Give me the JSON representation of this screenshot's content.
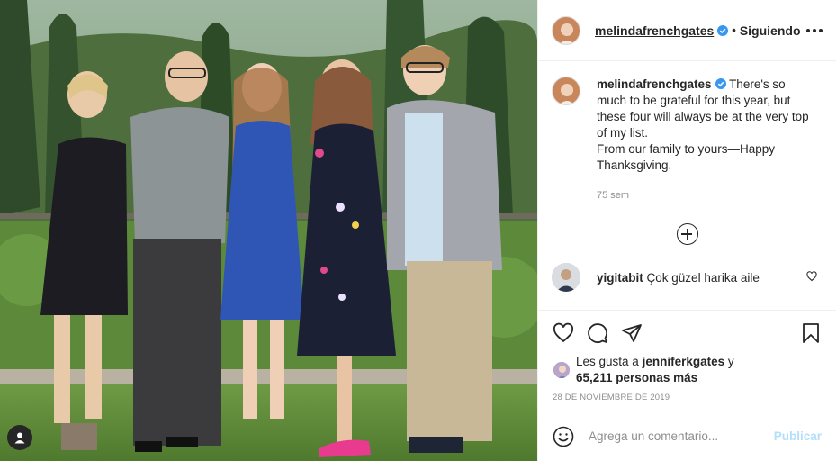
{
  "photo": {
    "alt_icon": "user-tag-icon"
  },
  "post": {
    "username": "melindafrenchgates",
    "verified": true,
    "separator": "•",
    "follow_status": "Siguiendo",
    "caption": {
      "username": "melindafrenchgates",
      "lines": [
        "There's so much to be grateful for this year, but these four will always be at the very top of my list.",
        "From our family to yours—Happy Thanksgiving."
      ],
      "time": "75 sem"
    },
    "comments": [
      {
        "username": "yigitabit",
        "text": "Çok güzel harika aile"
      }
    ],
    "likes": {
      "prefix": "Les gusta a",
      "liker": "jenniferkgates",
      "joiner": "y",
      "others": "65,211 personas más"
    },
    "date": "28 DE NOVIEMBRE DE 2019",
    "comment_box": {
      "placeholder": "Agrega un comentario...",
      "publish_label": "Publicar"
    }
  },
  "colors": {
    "text": "#262626",
    "secondary": "#8e8e8e",
    "verified": "#3897f0",
    "publish_disabled": "#b2dffc",
    "border": "#efefef"
  }
}
